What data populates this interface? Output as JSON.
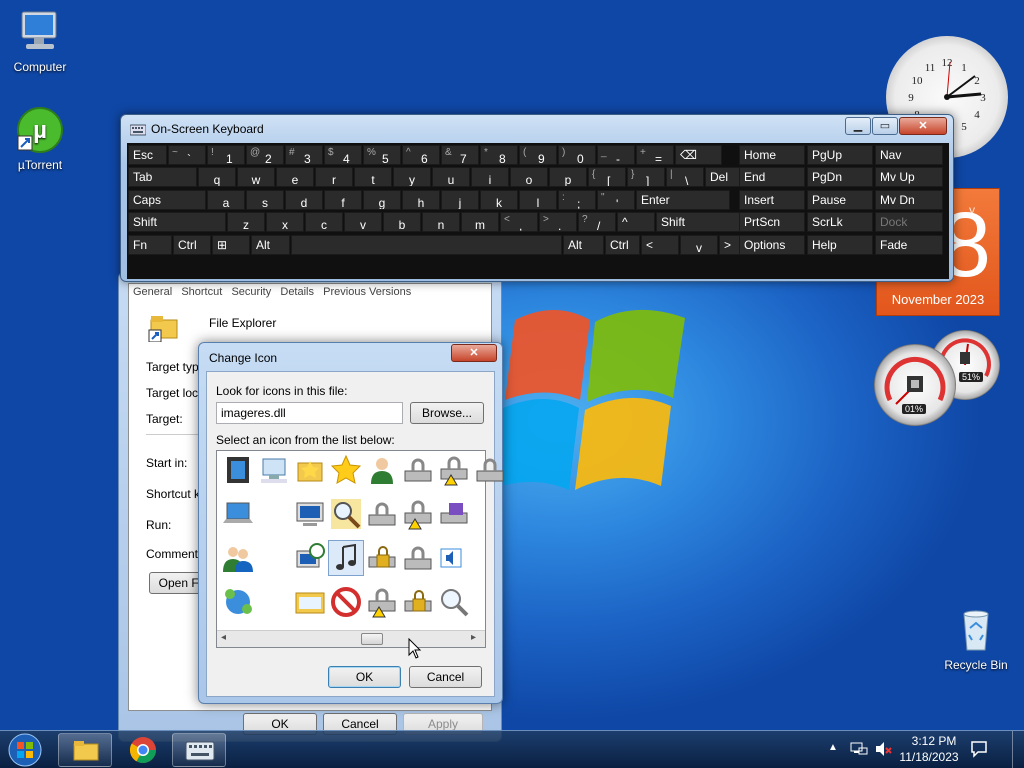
{
  "desktop": {
    "icons": [
      {
        "label": "Computer"
      },
      {
        "label": "µTorrent"
      },
      {
        "label": "Recycle Bin"
      }
    ]
  },
  "gadgets": {
    "calendar": {
      "day_fragment": "y",
      "date": "8",
      "month": "November 2023"
    },
    "cpu_meter": {
      "cpu": "01%",
      "ram": "51%"
    }
  },
  "osk": {
    "title": "On-Screen Keyboard",
    "rows": [
      [
        {
          "label": "Esc"
        },
        {
          "sub": "~",
          "main": "`"
        },
        {
          "sub": "!",
          "main": "1"
        },
        {
          "sub": "@",
          "main": "2"
        },
        {
          "sub": "#",
          "main": "3"
        },
        {
          "sub": "$",
          "main": "4"
        },
        {
          "sub": "%",
          "main": "5"
        },
        {
          "sub": "^",
          "main": "6"
        },
        {
          "sub": "&",
          "main": "7"
        },
        {
          "sub": "*",
          "main": "8"
        },
        {
          "sub": "(",
          "main": "9"
        },
        {
          "sub": ")",
          "main": "0"
        },
        {
          "sub": "_",
          "main": "-"
        },
        {
          "sub": "+",
          "main": "="
        },
        {
          "label": "⌫"
        }
      ],
      [
        {
          "label": "Tab"
        },
        {
          "label": "q"
        },
        {
          "label": "w"
        },
        {
          "label": "e"
        },
        {
          "label": "r"
        },
        {
          "label": "t"
        },
        {
          "label": "y"
        },
        {
          "label": "u"
        },
        {
          "label": "i"
        },
        {
          "label": "o"
        },
        {
          "label": "p"
        },
        {
          "sub": "{",
          "main": "["
        },
        {
          "sub": "}",
          "main": "]"
        },
        {
          "sub": "|",
          "main": "\\"
        },
        {
          "label": "Del"
        }
      ],
      [
        {
          "label": "Caps"
        },
        {
          "label": "a"
        },
        {
          "label": "s"
        },
        {
          "label": "d"
        },
        {
          "label": "f"
        },
        {
          "label": "g"
        },
        {
          "label": "h"
        },
        {
          "label": "j"
        },
        {
          "label": "k"
        },
        {
          "label": "l"
        },
        {
          "sub": ":",
          "main": ";"
        },
        {
          "sub": "\"",
          "main": "'"
        },
        {
          "label": "Enter"
        }
      ],
      [
        {
          "label": "Shift"
        },
        {
          "label": "z"
        },
        {
          "label": "x"
        },
        {
          "label": "c"
        },
        {
          "label": "v"
        },
        {
          "label": "b"
        },
        {
          "label": "n"
        },
        {
          "label": "m"
        },
        {
          "sub": "<",
          "main": ","
        },
        {
          "sub": ">",
          "main": "."
        },
        {
          "sub": "?",
          "main": "/"
        },
        {
          "label": "^"
        },
        {
          "label": "Shift"
        }
      ],
      [
        {
          "label": "Fn"
        },
        {
          "label": "Ctrl"
        },
        {
          "label": "⊞"
        },
        {
          "label": "Alt"
        },
        {
          "label": ""
        },
        {
          "label": "Alt"
        },
        {
          "label": "Ctrl"
        },
        {
          "label": "<"
        },
        {
          "label": "v"
        },
        {
          "label": ">"
        },
        {
          "label": "▤"
        }
      ]
    ],
    "nav_keys": [
      [
        "Home",
        "PgUp",
        "Nav"
      ],
      [
        "End",
        "PgDn",
        "Mv Up"
      ],
      [
        "Insert",
        "Pause",
        "Mv Dn"
      ],
      [
        "PrtScn",
        "ScrLk",
        "Dock"
      ],
      [
        "Options",
        "Help",
        "Fade"
      ]
    ]
  },
  "properties": {
    "tabs": [
      "General",
      "Shortcut",
      "Security",
      "Details",
      "Previous Versions"
    ],
    "app_name": "File Explorer",
    "labels": [
      "Target type:",
      "Target loca",
      "Target:",
      "Start in:",
      "Shortcut ke",
      "Run:",
      "Comment:"
    ],
    "open_button": "Open Fi",
    "ok": "OK",
    "cancel": "Cancel",
    "apply": "Apply"
  },
  "change_icon": {
    "title": "Change Icon",
    "look_label": "Look for icons in this file:",
    "file_value": "imageres.dll",
    "browse": "Browse...",
    "select_label": "Select an icon from the list below:",
    "ok": "OK",
    "cancel": "Cancel",
    "selected_icon": "music-note-icon"
  },
  "taskbar": {
    "time": "3:12 PM",
    "date": "11/18/2023"
  }
}
